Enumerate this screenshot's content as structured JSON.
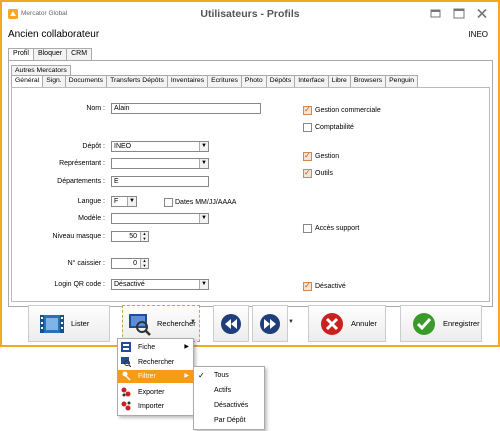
{
  "titlebar": {
    "app_name": "Mercator Global",
    "title": "Utilisateurs - Profils"
  },
  "header": {
    "title": "Ancien collaborateur",
    "code": "INEO"
  },
  "top_tabs": [
    {
      "label": "Profil",
      "active": true
    },
    {
      "label": "Bloquer"
    },
    {
      "label": "CRM"
    }
  ],
  "tabs_row1": [
    {
      "label": "Autres Mercators"
    }
  ],
  "tabs_row2": [
    {
      "label": "Général",
      "active": true
    },
    {
      "label": "Sign."
    },
    {
      "label": "Documents"
    },
    {
      "label": "Transferts Dépôts"
    },
    {
      "label": "Inventaires"
    },
    {
      "label": "Ecritures"
    },
    {
      "label": "Photo"
    },
    {
      "label": "Dépôts"
    },
    {
      "label": "Interface"
    },
    {
      "label": "Libre"
    },
    {
      "label": "Browsers"
    },
    {
      "label": "Penguin"
    }
  ],
  "form": {
    "nom": {
      "label": "Nom :",
      "value": "Alain"
    },
    "depot": {
      "label": "Dépôt :",
      "value": "INEO"
    },
    "representant": {
      "label": "Représentant :",
      "value": ""
    },
    "departements": {
      "label": "Départements :",
      "value": "E"
    },
    "langue": {
      "label": "Langue :",
      "value": "F"
    },
    "dates_format": {
      "label": "Dates MM/JJ/AAAA",
      "checked": false
    },
    "modele": {
      "label": "Modèle :",
      "value": ""
    },
    "niveau_masque": {
      "label": "Niveau masque :",
      "value": "50"
    },
    "no_caissier": {
      "label": "N° caissier :",
      "value": "0"
    },
    "login_qr": {
      "label": "Login QR code :",
      "value": "Désactivé"
    }
  },
  "checks": {
    "gestion_commerciale": {
      "label": "Gestion commerciale",
      "checked": true
    },
    "comptabilite": {
      "label": "Comptabilité",
      "checked": false
    },
    "gestion": {
      "label": "Gestion",
      "checked": true
    },
    "outils": {
      "label": "Outils",
      "checked": true
    },
    "acces_support": {
      "label": "Accès support",
      "checked": false
    },
    "desactive": {
      "label": "Désactivé",
      "checked": true
    }
  },
  "buttons": {
    "lister": "Lister",
    "rechercher": "Rechercher",
    "annuler": "Annuler",
    "enregistrer": "Enregistrer"
  },
  "menu": {
    "items": [
      {
        "label": "Fiche",
        "icon": "fiche-icon",
        "submenu": true
      },
      {
        "label": "Rechercher",
        "icon": "search-icon"
      },
      {
        "label": "Filtrer",
        "icon": "filter-icon",
        "submenu": true,
        "highlighted": true
      },
      {
        "label": "Exporter",
        "icon": "export-icon"
      },
      {
        "label": "Importer",
        "icon": "import-icon"
      }
    ],
    "submenu": [
      {
        "label": "Tous",
        "checked": true
      },
      {
        "label": "Actifs"
      },
      {
        "label": "Désactivés"
      },
      {
        "label": "Par Dépôt"
      }
    ]
  },
  "colors": {
    "accent": "#f5a623",
    "highlight": "#f59b17",
    "check": "#c06020"
  }
}
